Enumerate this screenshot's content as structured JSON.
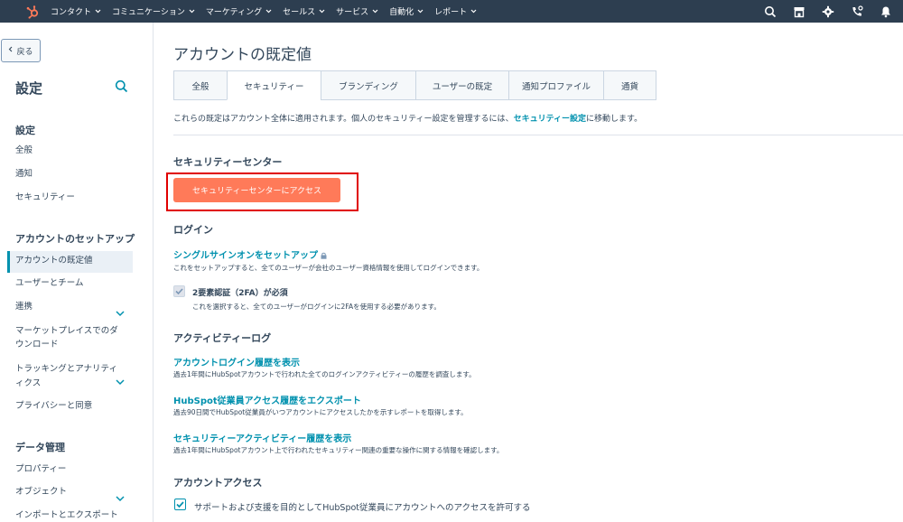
{
  "nav": {
    "items": [
      "コンタクト",
      "コミュニケーション",
      "マーケティング",
      "セールス",
      "サービス",
      "自動化",
      "レポート"
    ]
  },
  "sidebar": {
    "back_label": "戻る",
    "title": "設定",
    "sections": [
      {
        "title": "設定",
        "items": [
          "全般",
          "通知",
          "セキュリティー"
        ]
      },
      {
        "title": "アカウントのセットアップ",
        "items": [
          "アカウントの既定値",
          "ユーザーとチーム",
          "連携",
          "マーケットプレイスでのダ",
          "ウンロード",
          "トラッキングとアナリティ",
          "ィクス",
          "プライバシーと同意"
        ]
      },
      {
        "title": "データ管理",
        "items": [
          "プロパティー",
          "オブジェクト",
          "インポートとエクスポート"
        ]
      }
    ]
  },
  "main": {
    "title": "アカウントの既定値",
    "tabs": [
      "全般",
      "セキュリティー",
      "ブランディング",
      "ユーザーの既定",
      "通知プロファイル",
      "通貨"
    ],
    "active_tab": "セキュリティー",
    "intro_text": "これらの既定はアカウント全体に適用されます。個人のセキュリティー設定を管理するには、",
    "intro_link": "セキュリティー設定",
    "intro_suffix": "に移動します。",
    "security_center": {
      "heading": "セキュリティーセンター",
      "button_label": "セキュリティーセンターにアクセス"
    },
    "login": {
      "heading": "ログイン",
      "sso_link": "シングルサインオンをセットアップ",
      "sso_desc": "これをセットアップすると、全てのユーザーが会社のユーザー資格情報を使用してログインできます。",
      "twofa_label": "2要素認証（2FA）が必須",
      "twofa_desc": "これを選択すると、全てのユーザーがログインに2FAを使用する必要があります。"
    },
    "activity": {
      "heading": "アクティビティーログ",
      "items": [
        {
          "link": "アカウントログイン履歴を表示",
          "desc": "過去1年間にHubSpotアカウントで行われた全てのログインアクティビティーの履歴を調査します。"
        },
        {
          "link": "HubSpot従業員アクセス履歴をエクスポート",
          "desc": "過去90日間でHubSpot従業員がいつアカウントにアクセスしたかを示すレポートを取得します。"
        },
        {
          "link": "セキュリティーアクティビティー履歴を表示",
          "desc": "過去1年間にHubSpotアカウント上で行われたセキュリティー関連の重要な操作に関する情報を確認します。"
        }
      ]
    },
    "account_access": {
      "heading": "アカウントアクセス",
      "label": "サポートおよび支援を目的としてHubSpot従業員にアカウントへのアクセスを許可する"
    }
  },
  "colors": {
    "topnav": "#2d3e50",
    "accent": "#0091ae",
    "primary_button": "#ff7a59",
    "highlight": "#e00000",
    "logo": "#ff7a59"
  }
}
